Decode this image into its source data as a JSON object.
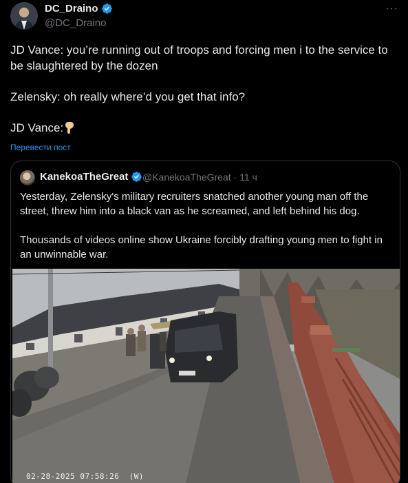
{
  "post": {
    "author_name": "DC_Draino",
    "author_handle": "@DC_Draino",
    "more_label": "···",
    "paragraphs": [
      "JD Vance: you’re running out of troops and forcing men i to the service to be slaughtered by the dozen",
      "Zelensky: oh really where’d you get that info?",
      "JD Vance:"
    ],
    "emoji": "backhand-index-pointing-down",
    "translate_label": "Перевести пост"
  },
  "quote": {
    "author_name": "KanekoaTheGreat",
    "author_handle": "@KanekoaTheGreat",
    "separator": "·",
    "time": "11 ч",
    "paragraphs": [
      "Yesterday, Zelensky's military recruiters snatched another young man off the street, threw him into a black van as he screamed, and left behind his dog.",
      "Thousands of videos online show Ukraine forcibly drafting young men to fight in an unwinnable war."
    ],
    "media_timestamp": "02-28-2025 07:58:26  (W)"
  },
  "colors": {
    "background": "#000000",
    "text": "#e7e9ea",
    "muted": "#71767b",
    "link": "#1d9bf0",
    "border": "#2f3336",
    "verified": "#1d9bf0"
  },
  "icons": {
    "verified": "verified-badge-icon",
    "more": "more-options-icon"
  }
}
